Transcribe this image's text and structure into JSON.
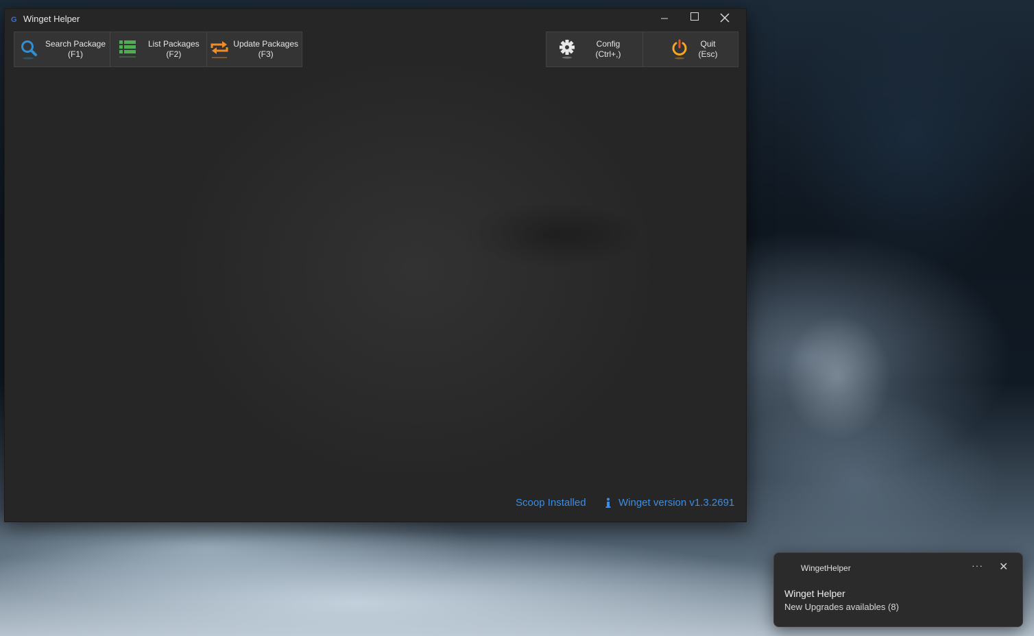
{
  "window": {
    "title": "Winget Helper"
  },
  "toolbar": {
    "left": [
      {
        "line1": "Search Package",
        "line2": "(F1)",
        "icon": "search-icon"
      },
      {
        "line1": "List Packages",
        "line2": "(F2)",
        "icon": "list-icon"
      },
      {
        "line1": "Update Packages",
        "line2": "(F3)",
        "icon": "update-icon"
      }
    ],
    "right": [
      {
        "line1": "Config",
        "line2": "(Ctrl+,)",
        "icon": "gear-icon"
      },
      {
        "line1": "Quit",
        "line2": "(Esc)",
        "icon": "power-icon"
      }
    ]
  },
  "status": {
    "scoop": "Scoop Installed",
    "winget": "Winget version v1.3.2691"
  },
  "toast": {
    "app_name": "WingetHelper",
    "more": "···",
    "close": "✕",
    "title": "Winget Helper",
    "body": "New Upgrades availables (8)"
  },
  "colors": {
    "accent_link": "#3b8ee6",
    "search_icon": "#2f8fd0",
    "list_icon": "#4caf50",
    "update_icon": "#f28c28",
    "power_icon": "#f5a623"
  }
}
